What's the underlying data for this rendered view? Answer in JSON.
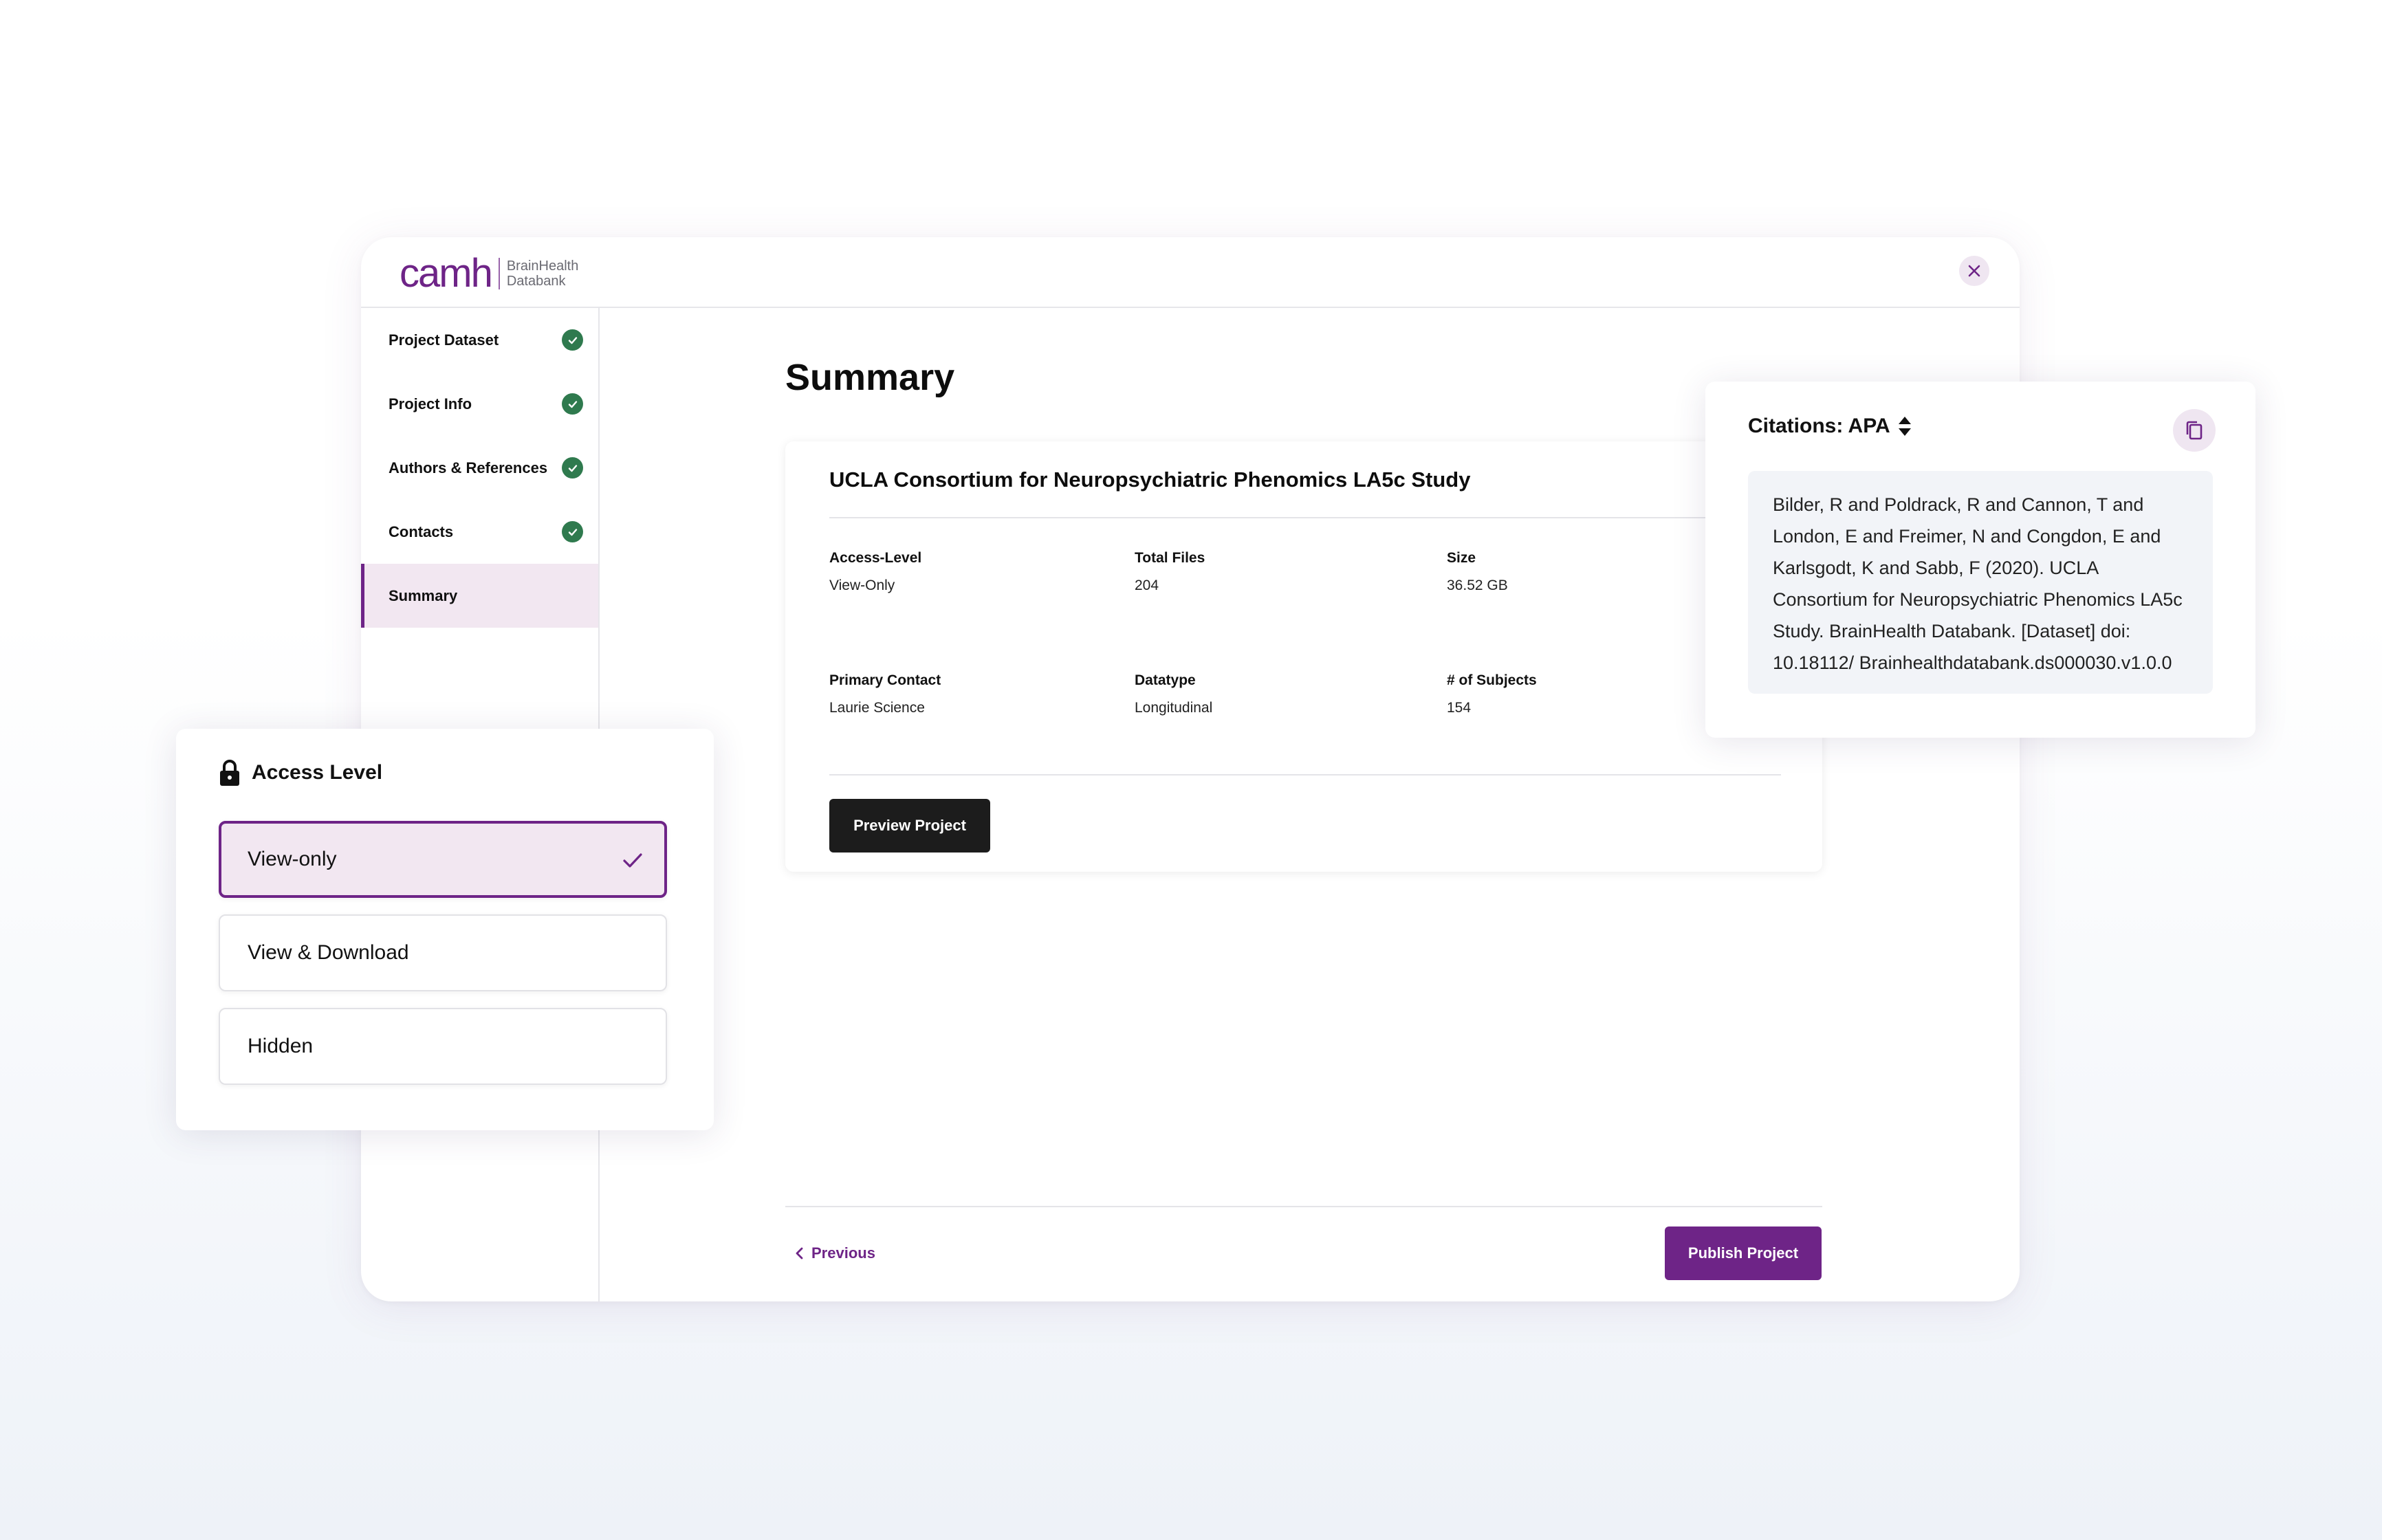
{
  "logo": {
    "main": "camh",
    "sub_line1": "BrainHealth",
    "sub_line2": "Databank"
  },
  "sidebar": {
    "items": [
      {
        "label": "Project Dataset",
        "completed": true,
        "active": false
      },
      {
        "label": "Project Info",
        "completed": true,
        "active": false
      },
      {
        "label": "Authors & References",
        "completed": true,
        "active": false
      },
      {
        "label": "Contacts",
        "completed": true,
        "active": false
      },
      {
        "label": "Summary",
        "completed": false,
        "active": true
      }
    ]
  },
  "main": {
    "title": "Summary",
    "project_name": "UCLA Consortium for Neuropsychiatric Phenomics LA5c Study",
    "fields": [
      {
        "label": "Access-Level",
        "value": "View-Only"
      },
      {
        "label": "Total Files",
        "value": "204"
      },
      {
        "label": "Size",
        "value": "36.52 GB"
      },
      {
        "label": "Primary Contact",
        "value": "Laurie Science"
      },
      {
        "label": "Datatype",
        "value": "Longitudinal"
      },
      {
        "label": "# of Subjects",
        "value": "154"
      }
    ],
    "preview_label": "Preview Project",
    "previous_label": "Previous",
    "publish_label": "Publish Project"
  },
  "access_level": {
    "title": "Access Level",
    "options": [
      {
        "label": "View-only",
        "selected": true
      },
      {
        "label": "View & Download",
        "selected": false
      },
      {
        "label": "Hidden",
        "selected": false
      }
    ]
  },
  "citations": {
    "title": "Citations: APA",
    "text": "Bilder, R and Poldrack, R and Cannon, T and London, E and Freimer, N and Congdon, E and Karlsgodt, K and Sabb, F (2020). UCLA Consortium for Neuropsychiatric Phenomics LA5c Study. BrainHealth Databank. [Dataset] doi: 10.18112/ Brainhealthdatabank.ds000030.v1.0.0"
  },
  "colors": {
    "brand_purple": "#6e2487",
    "active_tint": "#f2e7f1",
    "success_green": "#2f7a4e",
    "dark_button": "#1c1c1c"
  },
  "icons": {
    "close": "close-icon",
    "check": "check-circle-icon",
    "lock": "lock-icon",
    "sort": "sort-icon",
    "copy": "copy-icon",
    "chevron_left": "chevron-left-icon",
    "selected_check": "checkmark-icon"
  }
}
